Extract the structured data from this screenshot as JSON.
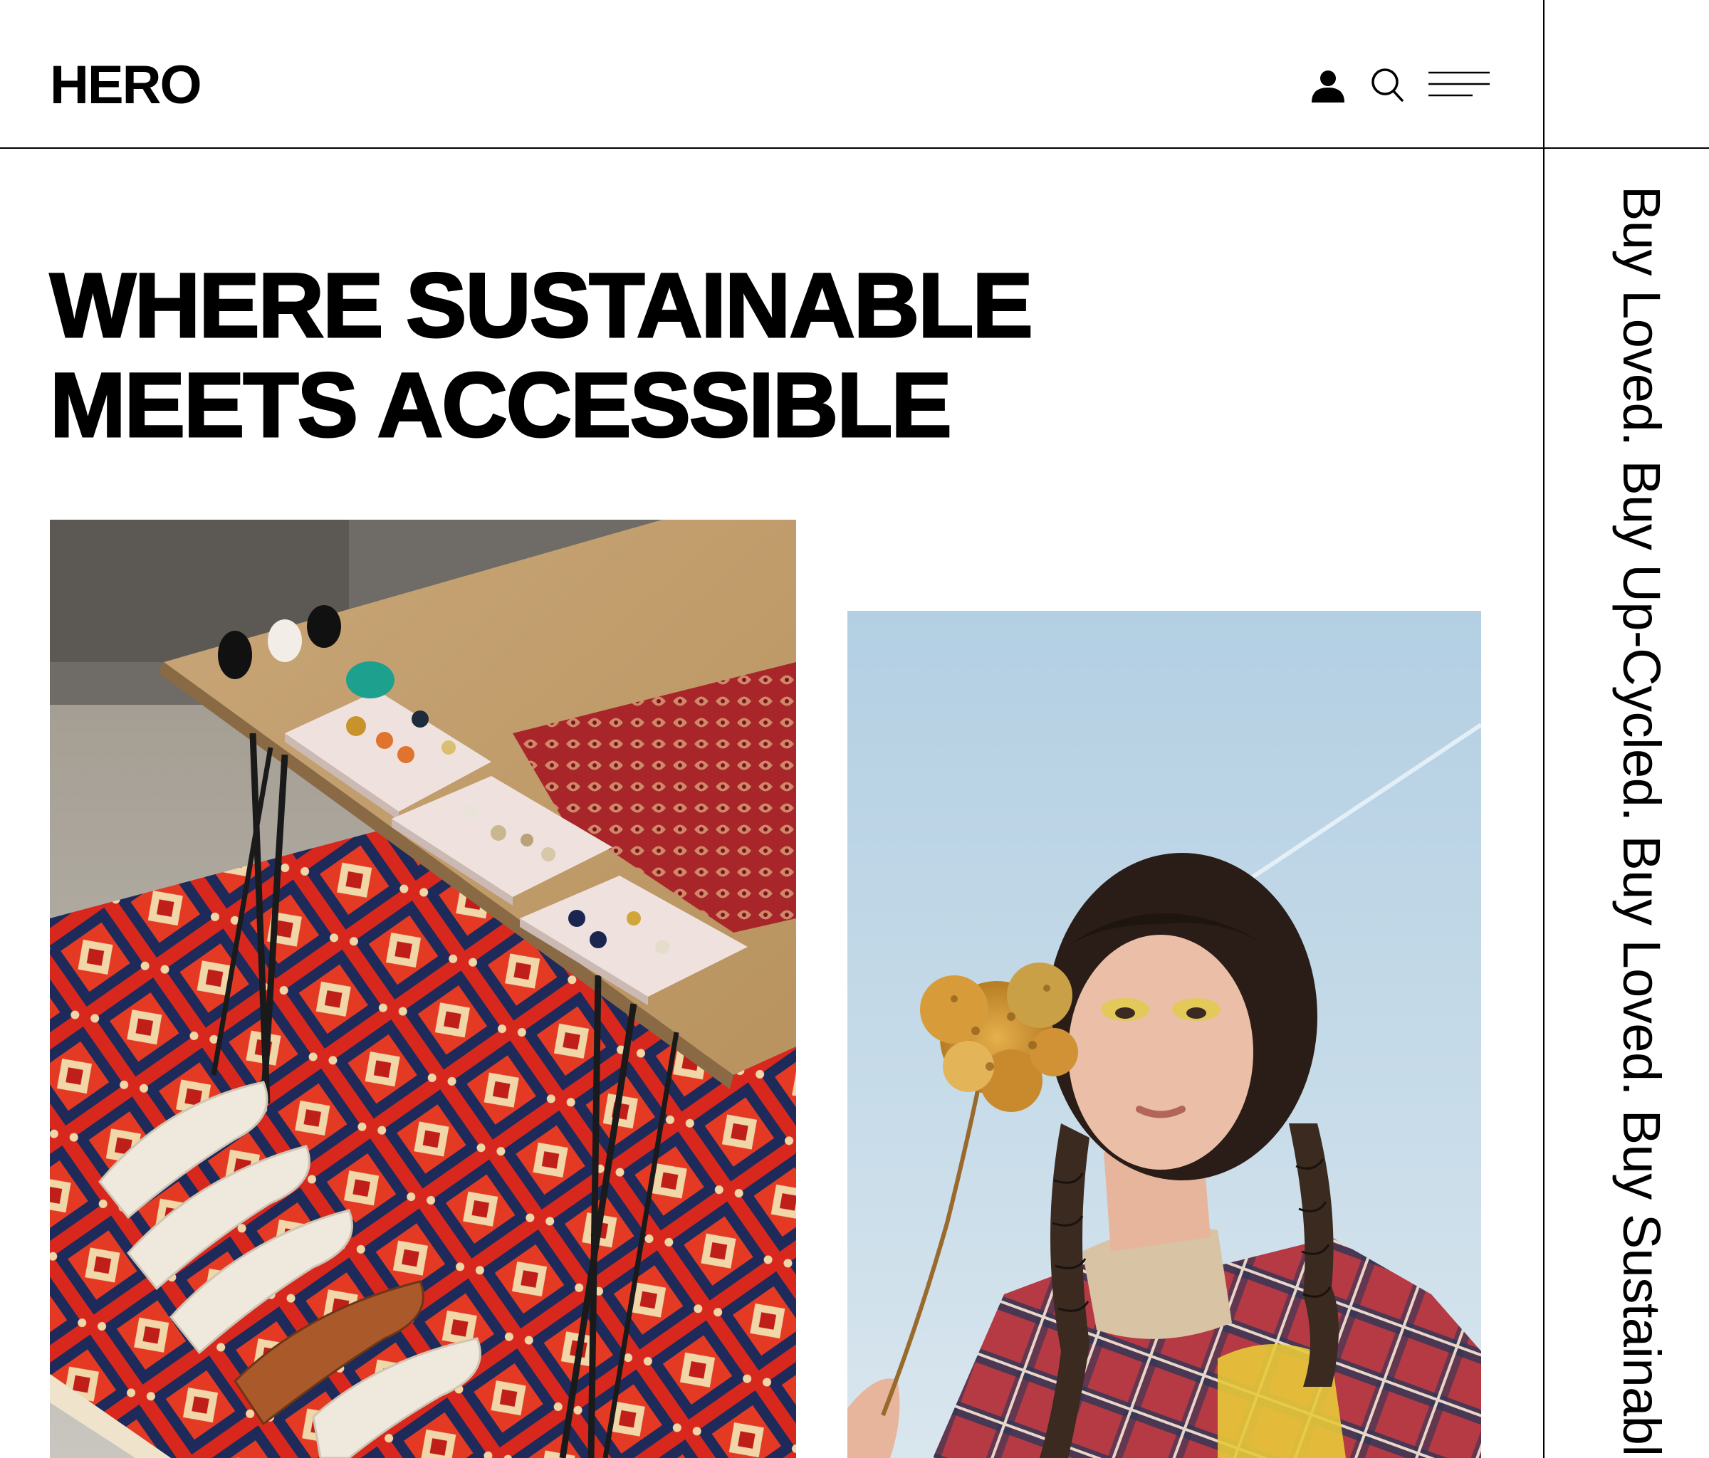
{
  "header": {
    "logo": "HERO",
    "icons": [
      "account-icon",
      "search-icon",
      "menu-icon"
    ]
  },
  "hero": {
    "title_line1": "WHERE SUSTAINABLE",
    "title_line2": "MEETS ACCESSIBLE"
  },
  "rail": {
    "tagline": "Buy Loved. Buy Up-Cycled. Buy Loved. Buy Sustainable."
  },
  "images": [
    {
      "name": "jewelry-table-photo",
      "subject": "wooden table with vintage earrings on display tiles, shoes on red patterned rug"
    },
    {
      "name": "portrait-photo",
      "subject": "young woman with braids holding a dried hydrangea against blue sky"
    }
  ],
  "colors": {
    "text": "#000000",
    "background": "#ffffff",
    "rule": "#000000"
  }
}
